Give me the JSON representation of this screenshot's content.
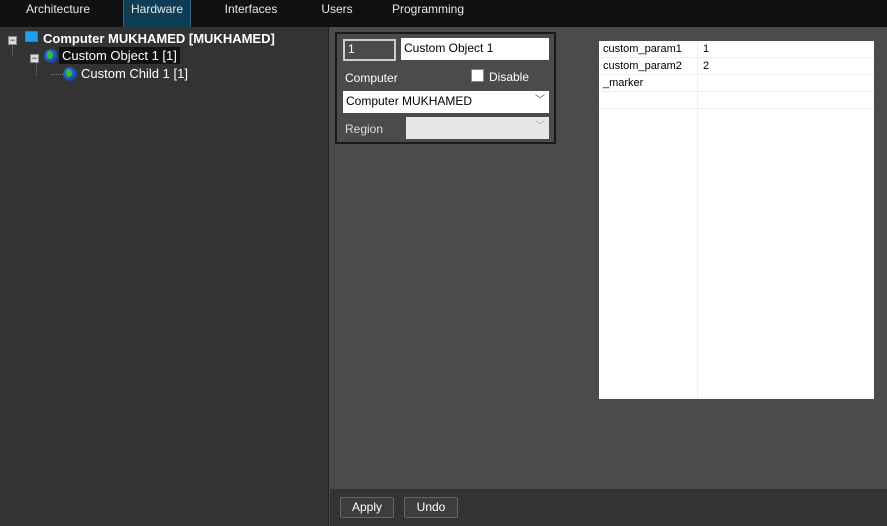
{
  "tabs": [
    "Architecture",
    "Hardware",
    "Interfaces",
    "Users",
    "Programming"
  ],
  "active_tab": "Hardware",
  "tree": {
    "root": "Computer MUKHAMED [MUKHAMED]",
    "child": "Custom Object 1 [1]",
    "grandchild": "Custom Child 1 [1]"
  },
  "form": {
    "id_value": "1",
    "name_value": "Custom Object 1",
    "computer_label": "Computer",
    "disable_label": "Disable",
    "disable_checked": false,
    "computer_value": "Computer MUKHAMED",
    "region_label": "Region",
    "region_value": ""
  },
  "params": [
    {
      "name": "custom_param1",
      "value": "1"
    },
    {
      "name": "custom_param2",
      "value": "2"
    },
    {
      "name": "_marker",
      "value": ""
    }
  ],
  "buttons": {
    "apply": "Apply",
    "undo": "Undo"
  }
}
